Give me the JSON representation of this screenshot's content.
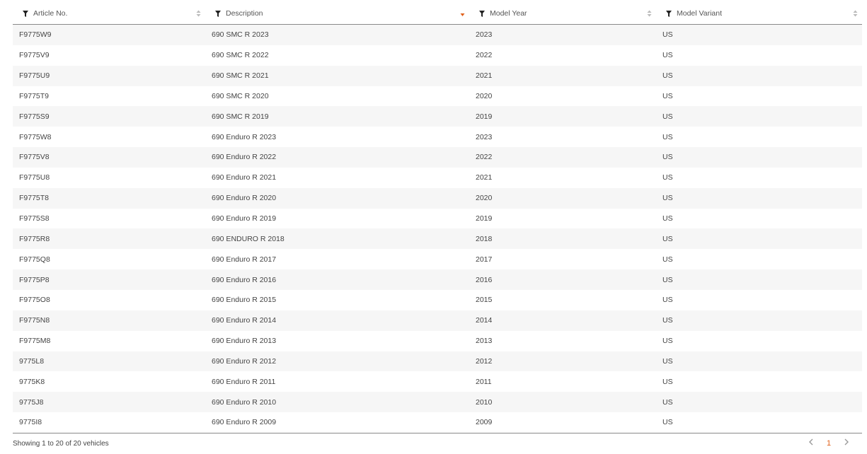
{
  "columns": [
    {
      "label": "Article No.",
      "sort": "none"
    },
    {
      "label": "Description",
      "sort": "desc"
    },
    {
      "label": "Model Year",
      "sort": "none"
    },
    {
      "label": "Model Variant",
      "sort": "none"
    }
  ],
  "rows": [
    [
      "F9775W9",
      "690 SMC R 2023",
      "2023",
      "US"
    ],
    [
      "F9775V9",
      "690 SMC R 2022",
      "2022",
      "US"
    ],
    [
      "F9775U9",
      "690 SMC R 2021",
      "2021",
      "US"
    ],
    [
      "F9775T9",
      "690 SMC R 2020",
      "2020",
      "US"
    ],
    [
      "F9775S9",
      "690 SMC R 2019",
      "2019",
      "US"
    ],
    [
      "F9775W8",
      "690 Enduro R 2023",
      "2023",
      "US"
    ],
    [
      "F9775V8",
      "690 Enduro R 2022",
      "2022",
      "US"
    ],
    [
      "F9775U8",
      "690 Enduro R 2021",
      "2021",
      "US"
    ],
    [
      "F9775T8",
      "690 Enduro R 2020",
      "2020",
      "US"
    ],
    [
      "F9775S8",
      "690 Enduro R 2019",
      "2019",
      "US"
    ],
    [
      "F9775R8",
      "690 ENDURO R 2018",
      "2018",
      "US"
    ],
    [
      "F9775Q8",
      "690 Enduro R 2017",
      "2017",
      "US"
    ],
    [
      "F9775P8",
      "690 Enduro R 2016",
      "2016",
      "US"
    ],
    [
      "F9775O8",
      "690 Enduro R 2015",
      "2015",
      "US"
    ],
    [
      "F9775N8",
      "690 Enduro R 2014",
      "2014",
      "US"
    ],
    [
      "F9775M8",
      "690 Enduro R 2013",
      "2013",
      "US"
    ],
    [
      "9775L8",
      "690 Enduro R 2012",
      "2012",
      "US"
    ],
    [
      "9775K8",
      "690 Enduro R 2011",
      "2011",
      "US"
    ],
    [
      "9775J8",
      "690 Enduro R 2010",
      "2010",
      "US"
    ],
    [
      "9775I8",
      "690 Enduro R 2009",
      "2009",
      "US"
    ]
  ],
  "footer": {
    "summary": "Showing 1 to 20 of 20 vehicles",
    "current_page": "1",
    "prev_icon": "chevron-left-icon",
    "next_icon": "chevron-right-icon"
  },
  "colors": {
    "accent": "#e0601a",
    "row_stripe": "#f6f6f6",
    "text": "#444444"
  }
}
